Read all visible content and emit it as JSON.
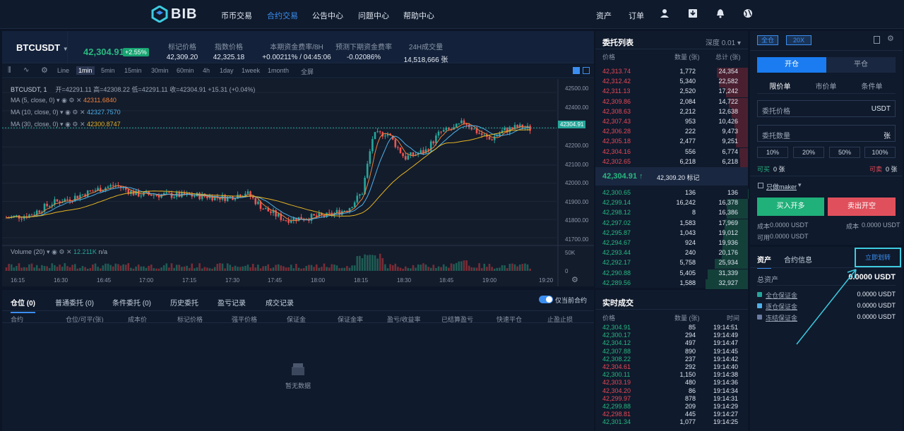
{
  "nav": {
    "logo": "BIB",
    "links": [
      "币币交易",
      "合约交易",
      "公告中心",
      "问题中心",
      "帮助中心"
    ],
    "active_index": 1,
    "assets": "资产",
    "orders": "订单"
  },
  "ticker": {
    "symbol": "BTCUSDT",
    "price": "42,304.91",
    "change": "+2.55%",
    "stats": [
      {
        "label": "标记价格",
        "value": "42,309.20"
      },
      {
        "label": "指数价格",
        "value": "42,325.18"
      },
      {
        "label": "本期资金费率/8H",
        "value": "+0.00211% / 04:45:06"
      },
      {
        "label": "预测下期资金费率",
        "value": "-0.02086%"
      },
      {
        "label": "24H成交量",
        "value": "14,518,666 张"
      }
    ]
  },
  "toolbar": {
    "timeframes": [
      "Line",
      "1min",
      "5min",
      "15min",
      "30min",
      "60min",
      "4h",
      "1day",
      "1week",
      "1month",
      "全屏"
    ],
    "active": "1min"
  },
  "chart": {
    "header": "BTCUSDT, 1",
    "ohlc": "开=42291.11 高=42308.22 低=42291.11 收=42304.91 +15.31 (+0.04%)",
    "ma5": "MA (5, close, 0)",
    "ma5_val": "42311.6840",
    "ma10": "MA (10, close, 0)",
    "ma10_val": "42327.7570",
    "ma30": "MA (30, close, 0)",
    "ma30_val": "42300.8747",
    "current_price": "42304.91",
    "volume_label": "Volume (20)",
    "volume_val": "12.211K",
    "volume_na": "n/a",
    "y_ticks": [
      "42500.00",
      "42400.00",
      "42300.00",
      "42200.00",
      "42100.00",
      "42000.00",
      "41900.00",
      "41800.00",
      "41700.00"
    ],
    "vol_ticks": [
      "50K",
      "0"
    ],
    "x_ticks": [
      "16:15",
      "16:30",
      "16:45",
      "17:00",
      "17:15",
      "17:30",
      "17:45",
      "18:00",
      "18:15",
      "18:30",
      "18:45",
      "19:00",
      "19:20"
    ],
    "colors": {
      "up": "#26a69a",
      "down": "#ef5350",
      "ma5": "#f0803c",
      "ma10": "#4fb0e8",
      "ma30": "#e6b422"
    }
  },
  "bottom": {
    "tabs": [
      "仓位 (0)",
      "普通委托 (0)",
      "条件委托 (0)",
      "历史委托",
      "盈亏记录",
      "成交记录"
    ],
    "toggle_label": "仅当前合约",
    "columns": [
      "合约",
      "仓位/可平(张)",
      "成本价",
      "标记价格",
      "强平价格",
      "保证金",
      "保证金率",
      "盈亏/收益率",
      "已结算盈亏",
      "快速平仓",
      "止盈止损"
    ],
    "empty": "暂无数据"
  },
  "orderbook": {
    "title": "委托列表",
    "depth": "深度 0.01",
    "headers": [
      "价格",
      "数量 (张)",
      "总计 (张)"
    ],
    "asks": [
      [
        "42,313.74",
        "1,772",
        "24,354"
      ],
      [
        "42,312.42",
        "5,340",
        "22,582"
      ],
      [
        "42,311.13",
        "2,520",
        "17,242"
      ],
      [
        "42,309.86",
        "2,084",
        "14,722"
      ],
      [
        "42,308.63",
        "2,212",
        "12,638"
      ],
      [
        "42,307.43",
        "953",
        "10,426"
      ],
      [
        "42,306.28",
        "222",
        "9,473"
      ],
      [
        "42,305.18",
        "2,477",
        "9,251"
      ],
      [
        "42,304.16",
        "556",
        "6,774"
      ],
      [
        "42,302.65",
        "6,218",
        "6,218"
      ]
    ],
    "mid_price": "42,304.91 ↑",
    "mark_price": "42,309.20 标记",
    "bids": [
      [
        "42,300.65",
        "136",
        "136"
      ],
      [
        "42,299.14",
        "16,242",
        "16,378"
      ],
      [
        "42,298.12",
        "8",
        "16,386"
      ],
      [
        "42,297.02",
        "1,583",
        "17,969"
      ],
      [
        "42,295.87",
        "1,043",
        "19,012"
      ],
      [
        "42,294.67",
        "924",
        "19,936"
      ],
      [
        "42,293.44",
        "240",
        "20,176"
      ],
      [
        "42,292.17",
        "5,758",
        "25,934"
      ],
      [
        "42,290.88",
        "5,405",
        "31,339"
      ],
      [
        "42,289.56",
        "1,588",
        "32,927"
      ]
    ]
  },
  "trades": {
    "title": "实时成交",
    "headers": [
      "价格",
      "数量 (张)",
      "时间"
    ],
    "rows": [
      [
        "42,304.91",
        "85",
        "19:14:51",
        "up"
      ],
      [
        "42,300.17",
        "294",
        "19:14:49",
        "up"
      ],
      [
        "42,304.12",
        "497",
        "19:14:47",
        "up"
      ],
      [
        "42,307.88",
        "890",
        "19:14:45",
        "up"
      ],
      [
        "42,308.22",
        "237",
        "19:14:42",
        "up"
      ],
      [
        "42,304.61",
        "292",
        "19:14:40",
        "down"
      ],
      [
        "42,300.11",
        "1,150",
        "19:14:38",
        "up"
      ],
      [
        "42,303.19",
        "480",
        "19:14:36",
        "down"
      ],
      [
        "42,304.20",
        "86",
        "19:14:34",
        "down"
      ],
      [
        "42,299.97",
        "878",
        "19:14:31",
        "down"
      ],
      [
        "42,299.88",
        "209",
        "19:14:29",
        "up"
      ],
      [
        "42,298.81",
        "445",
        "19:14:27",
        "down"
      ],
      [
        "42,301.34",
        "1,077",
        "19:14:25",
        "up"
      ]
    ]
  },
  "panel": {
    "margin_mode": "全仓",
    "leverage": "20X",
    "open": "开仓",
    "close": "平仓",
    "order_types": [
      "限价单",
      "市价单",
      "条件单"
    ],
    "price_label": "委托价格",
    "price_unit": "USDT",
    "qty_label": "委托数量",
    "qty_unit": "张",
    "pcts": [
      "10%",
      "20%",
      "50%",
      "100%"
    ],
    "can_buy": "可买",
    "can_buy_val": "0 张",
    "can_sell": "可卖",
    "can_sell_val": "0 张",
    "maker_only": "只做maker",
    "buy_btn": "买入开多",
    "sell_btn": "卖出开空",
    "cost_l": "成本",
    "cost_l_val": "0.0000 USDT",
    "cost_r": "成本",
    "cost_r_val": "0.0000 USDT",
    "available": "可用",
    "available_val": "0.0000 USDT"
  },
  "assets": {
    "tab_assets": "资产",
    "tab_info": "合约信息",
    "transfer": "立即划转",
    "total_label": "总资产",
    "total_val": "0.0000 USDT",
    "rows": [
      {
        "name": "全仓保证金",
        "value": "0.0000 USDT",
        "color": "#26a69a"
      },
      {
        "name": "逐仓保证金",
        "value": "0.0000 USDT",
        "color": "#4fb0e8"
      },
      {
        "name": "冻结保证金",
        "value": "0.0000 USDT",
        "color": "#6b7aa0"
      }
    ]
  }
}
